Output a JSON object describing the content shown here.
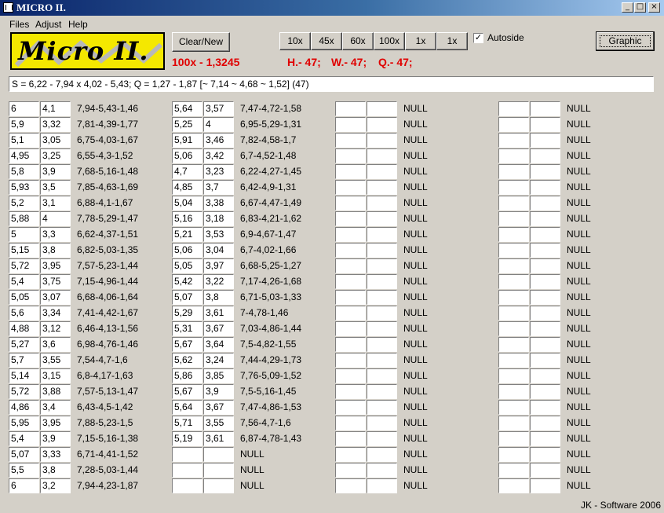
{
  "window": {
    "title": "MICRO II.",
    "minimize": "_",
    "maximize": "□",
    "close": "×"
  },
  "menu": [
    "Files",
    "Adjust",
    "Help"
  ],
  "logo_text": "Micro II.",
  "toolbar": {
    "clear_new": "Clear/New",
    "zoom_buttons": [
      "10x",
      "45x",
      "60x",
      "100x",
      "1x",
      "1x"
    ],
    "autoside_label": "Autoside",
    "autoside_checked": true,
    "graphic": "Graphic"
  },
  "status": {
    "zoom": "100x - 1,3245",
    "h": "H.- 47;",
    "w": "W.- 47;",
    "q": "Q.- 47;"
  },
  "formula": "S = 6,22 - 7,94 x 4,02 - 5,43; Q = 1,27 - 1,87 [~ 7,14 ~ 4,68 ~ 1,52] (47)",
  "columns": [
    {
      "rows": [
        {
          "a": "6",
          "b": "4,1",
          "r": "7,94-5,43-1,46"
        },
        {
          "a": "5,9",
          "b": "3,32",
          "r": "7,81-4,39-1,77"
        },
        {
          "a": "5,1",
          "b": "3,05",
          "r": "6,75-4,03-1,67"
        },
        {
          "a": "4,95",
          "b": "3,25",
          "r": "6,55-4,3-1,52"
        },
        {
          "a": "5,8",
          "b": "3,9",
          "r": "7,68-5,16-1,48"
        },
        {
          "a": "5,93",
          "b": "3,5",
          "r": "7,85-4,63-1,69"
        },
        {
          "a": "5,2",
          "b": "3,1",
          "r": "6,88-4,1-1,67"
        },
        {
          "a": "5,88",
          "b": "4",
          "r": "7,78-5,29-1,47"
        },
        {
          "a": "5",
          "b": "3,3",
          "r": "6,62-4,37-1,51"
        },
        {
          "a": "5,15",
          "b": "3,8",
          "r": "6,82-5,03-1,35"
        },
        {
          "a": "5,72",
          "b": "3,95",
          "r": "7,57-5,23-1,44"
        },
        {
          "a": "5,4",
          "b": "3,75",
          "r": "7,15-4,96-1,44"
        },
        {
          "a": "5,05",
          "b": "3,07",
          "r": "6,68-4,06-1,64"
        },
        {
          "a": "5,6",
          "b": "3,34",
          "r": "7,41-4,42-1,67"
        },
        {
          "a": "4,88",
          "b": "3,12",
          "r": "6,46-4,13-1,56"
        },
        {
          "a": "5,27",
          "b": "3,6",
          "r": "6,98-4,76-1,46"
        },
        {
          "a": "5,7",
          "b": "3,55",
          "r": "7,54-4,7-1,6"
        },
        {
          "a": "5,14",
          "b": "3,15",
          "r": "6,8-4,17-1,63"
        },
        {
          "a": "5,72",
          "b": "3,88",
          "r": "7,57-5,13-1,47"
        },
        {
          "a": "4,86",
          "b": "3,4",
          "r": "6,43-4,5-1,42"
        },
        {
          "a": "5,95",
          "b": "3,95",
          "r": "7,88-5,23-1,5"
        },
        {
          "a": "5,4",
          "b": "3,9",
          "r": "7,15-5,16-1,38"
        },
        {
          "a": "5,07",
          "b": "3,33",
          "r": "6,71-4,41-1,52"
        },
        {
          "a": "5,5",
          "b": "3,8",
          "r": "7,28-5,03-1,44"
        },
        {
          "a": "6",
          "b": "3,2",
          "r": "7,94-4,23-1,87"
        }
      ]
    },
    {
      "rows": [
        {
          "a": "5,64",
          "b": "3,57",
          "r": "7,47-4,72-1,58"
        },
        {
          "a": "5,25",
          "b": "4",
          "r": "6,95-5,29-1,31"
        },
        {
          "a": "5,91",
          "b": "3,46",
          "r": "7,82-4,58-1,7"
        },
        {
          "a": "5,06",
          "b": "3,42",
          "r": "6,7-4,52-1,48"
        },
        {
          "a": "4,7",
          "b": "3,23",
          "r": "6,22-4,27-1,45"
        },
        {
          "a": "4,85",
          "b": "3,7",
          "r": "6,42-4,9-1,31"
        },
        {
          "a": "5,04",
          "b": "3,38",
          "r": "6,67-4,47-1,49"
        },
        {
          "a": "5,16",
          "b": "3,18",
          "r": "6,83-4,21-1,62"
        },
        {
          "a": "5,21",
          "b": "3,53",
          "r": "6,9-4,67-1,47"
        },
        {
          "a": "5,06",
          "b": "3,04",
          "r": "6,7-4,02-1,66"
        },
        {
          "a": "5,05",
          "b": "3,97",
          "r": "6,68-5,25-1,27"
        },
        {
          "a": "5,42",
          "b": "3,22",
          "r": "7,17-4,26-1,68"
        },
        {
          "a": "5,07",
          "b": "3,8",
          "r": "6,71-5,03-1,33"
        },
        {
          "a": "5,29",
          "b": "3,61",
          "r": "7-4,78-1,46"
        },
        {
          "a": "5,31",
          "b": "3,67",
          "r": "7,03-4,86-1,44"
        },
        {
          "a": "5,67",
          "b": "3,64",
          "r": "7,5-4,82-1,55"
        },
        {
          "a": "5,62",
          "b": "3,24",
          "r": "7,44-4,29-1,73"
        },
        {
          "a": "5,86",
          "b": "3,85",
          "r": "7,76-5,09-1,52"
        },
        {
          "a": "5,67",
          "b": "3,9",
          "r": "7,5-5,16-1,45"
        },
        {
          "a": "5,64",
          "b": "3,67",
          "r": "7,47-4,86-1,53"
        },
        {
          "a": "5,71",
          "b": "3,55",
          "r": "7,56-4,7-1,6"
        },
        {
          "a": "5,19",
          "b": "3,61",
          "r": "6,87-4,78-1,43"
        },
        {
          "a": "",
          "b": "",
          "r": "NULL"
        },
        {
          "a": "",
          "b": "",
          "r": "NULL"
        },
        {
          "a": "",
          "b": "",
          "r": "NULL"
        }
      ]
    },
    {
      "rows": [
        {
          "a": "",
          "b": "",
          "r": "NULL"
        },
        {
          "a": "",
          "b": "",
          "r": "NULL"
        },
        {
          "a": "",
          "b": "",
          "r": "NULL"
        },
        {
          "a": "",
          "b": "",
          "r": "NULL"
        },
        {
          "a": "",
          "b": "",
          "r": "NULL"
        },
        {
          "a": "",
          "b": "",
          "r": "NULL"
        },
        {
          "a": "",
          "b": "",
          "r": "NULL"
        },
        {
          "a": "",
          "b": "",
          "r": "NULL"
        },
        {
          "a": "",
          "b": "",
          "r": "NULL"
        },
        {
          "a": "",
          "b": "",
          "r": "NULL"
        },
        {
          "a": "",
          "b": "",
          "r": "NULL"
        },
        {
          "a": "",
          "b": "",
          "r": "NULL"
        },
        {
          "a": "",
          "b": "",
          "r": "NULL"
        },
        {
          "a": "",
          "b": "",
          "r": "NULL"
        },
        {
          "a": "",
          "b": "",
          "r": "NULL"
        },
        {
          "a": "",
          "b": "",
          "r": "NULL"
        },
        {
          "a": "",
          "b": "",
          "r": "NULL"
        },
        {
          "a": "",
          "b": "",
          "r": "NULL"
        },
        {
          "a": "",
          "b": "",
          "r": "NULL"
        },
        {
          "a": "",
          "b": "",
          "r": "NULL"
        },
        {
          "a": "",
          "b": "",
          "r": "NULL"
        },
        {
          "a": "",
          "b": "",
          "r": "NULL"
        },
        {
          "a": "",
          "b": "",
          "r": "NULL"
        },
        {
          "a": "",
          "b": "",
          "r": "NULL"
        },
        {
          "a": "",
          "b": "",
          "r": "NULL"
        }
      ]
    },
    {
      "rows": [
        {
          "a": "",
          "b": "",
          "r": "NULL"
        },
        {
          "a": "",
          "b": "",
          "r": "NULL"
        },
        {
          "a": "",
          "b": "",
          "r": "NULL"
        },
        {
          "a": "",
          "b": "",
          "r": "NULL"
        },
        {
          "a": "",
          "b": "",
          "r": "NULL"
        },
        {
          "a": "",
          "b": "",
          "r": "NULL"
        },
        {
          "a": "",
          "b": "",
          "r": "NULL"
        },
        {
          "a": "",
          "b": "",
          "r": "NULL"
        },
        {
          "a": "",
          "b": "",
          "r": "NULL"
        },
        {
          "a": "",
          "b": "",
          "r": "NULL"
        },
        {
          "a": "",
          "b": "",
          "r": "NULL"
        },
        {
          "a": "",
          "b": "",
          "r": "NULL"
        },
        {
          "a": "",
          "b": "",
          "r": "NULL"
        },
        {
          "a": "",
          "b": "",
          "r": "NULL"
        },
        {
          "a": "",
          "b": "",
          "r": "NULL"
        },
        {
          "a": "",
          "b": "",
          "r": "NULL"
        },
        {
          "a": "",
          "b": "",
          "r": "NULL"
        },
        {
          "a": "",
          "b": "",
          "r": "NULL"
        },
        {
          "a": "",
          "b": "",
          "r": "NULL"
        },
        {
          "a": "",
          "b": "",
          "r": "NULL"
        },
        {
          "a": "",
          "b": "",
          "r": "NULL"
        },
        {
          "a": "",
          "b": "",
          "r": "NULL"
        },
        {
          "a": "",
          "b": "",
          "r": "NULL"
        },
        {
          "a": "",
          "b": "",
          "r": "NULL"
        },
        {
          "a": "",
          "b": "",
          "r": "NULL"
        }
      ]
    }
  ],
  "footer": "JK - Software 2006"
}
